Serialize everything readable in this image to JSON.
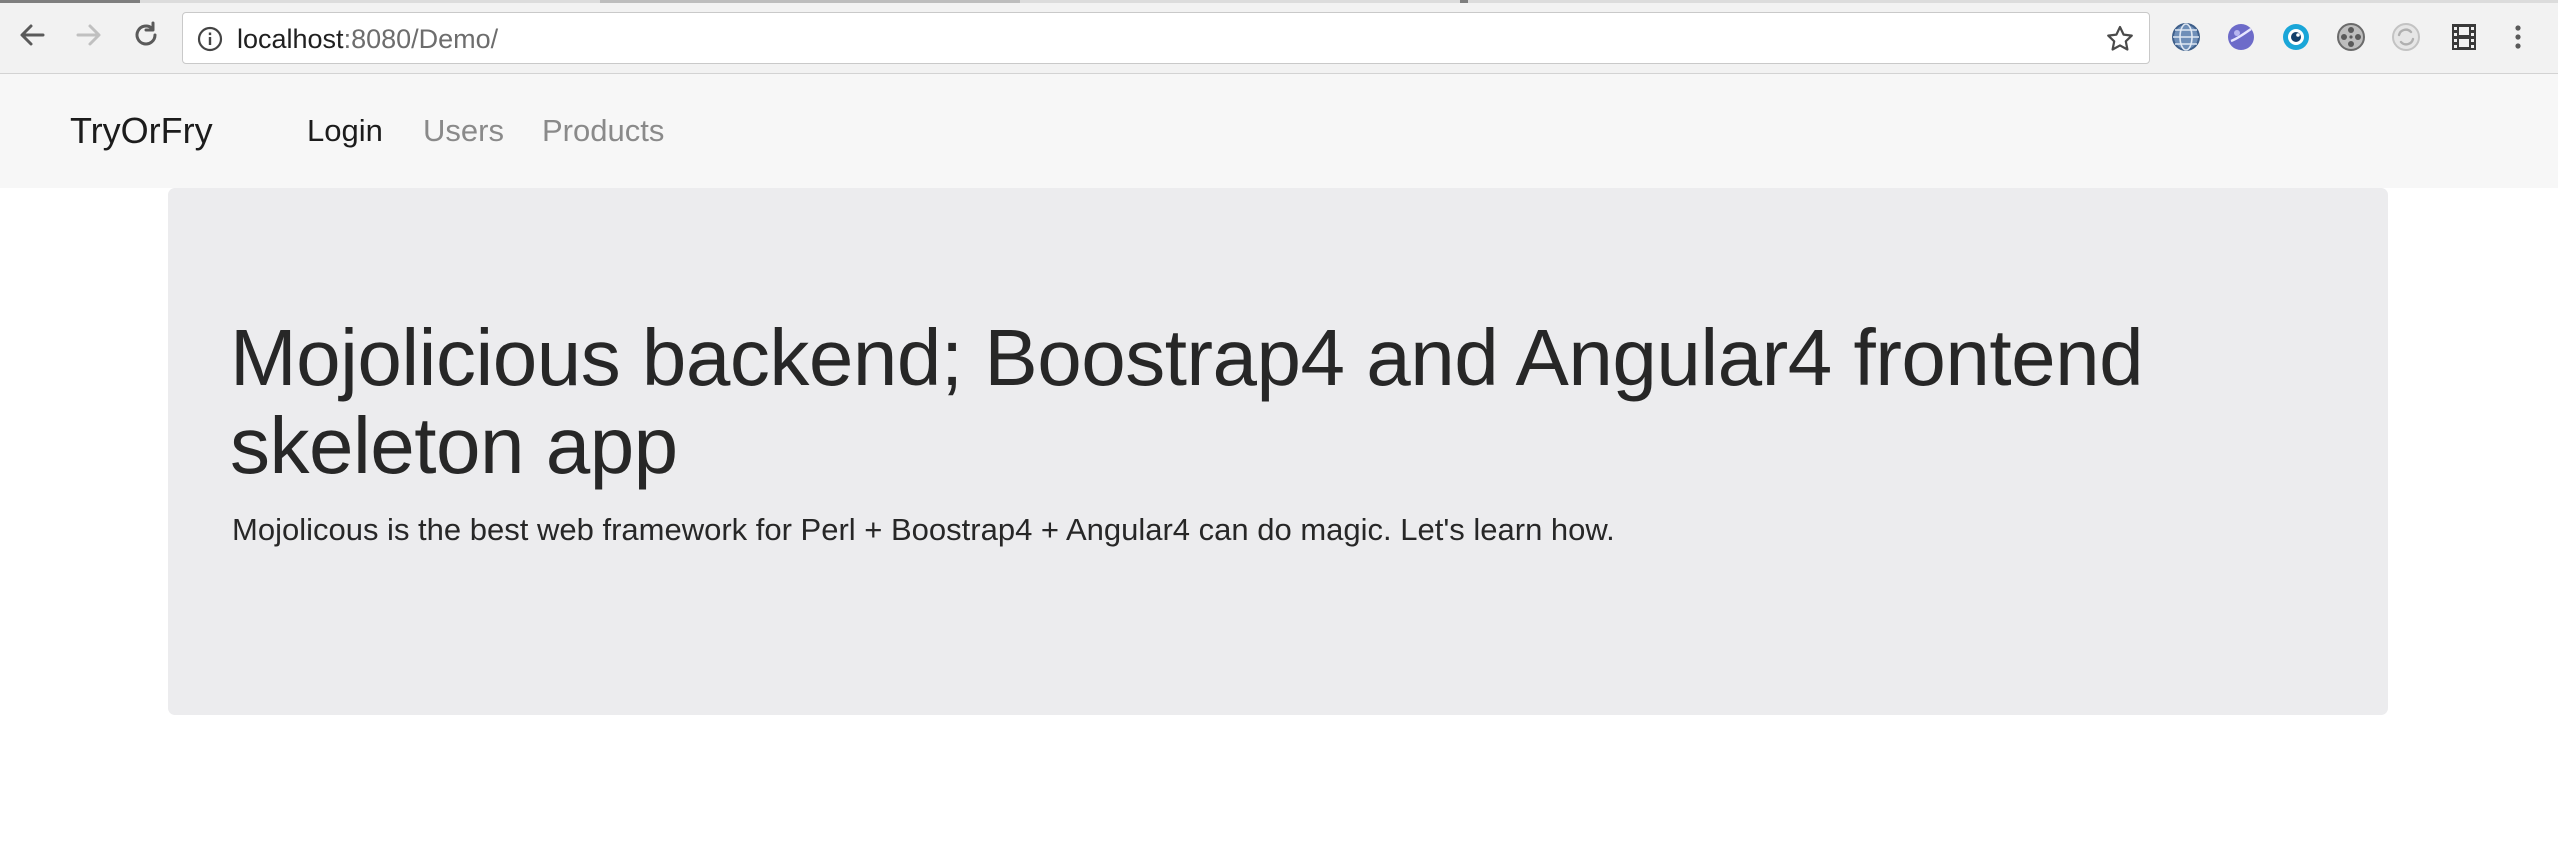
{
  "browser": {
    "url_host": "localhost",
    "url_path": ":8080/Demo/",
    "icons": {
      "back": "back-arrow-icon",
      "forward": "forward-arrow-icon",
      "reload": "reload-icon",
      "info": "info-icon",
      "bookmark": "star-icon",
      "menu": "kebab-menu-icon"
    },
    "extensions": [
      "globe-icon",
      "planet-icon",
      "eye-icon",
      "film-reel-icon",
      "sync-icon",
      "filmstrip-icon"
    ]
  },
  "navbar": {
    "brand": "TryOrFry",
    "links": [
      {
        "label": "Login",
        "active": true
      },
      {
        "label": "Users",
        "active": false
      },
      {
        "label": "Products",
        "active": false
      }
    ]
  },
  "jumbotron": {
    "heading": "Mojolicious backend; Boostrap4 and Angular4 frontend skeleton app",
    "lead": "Mojolicous is the best web framework for Perl + Boostrap4 + Angular4 can do magic. Let's learn how."
  },
  "colors": {
    "navbar_bg": "#f7f7f7",
    "jumbotron_bg": "#ececee",
    "text": "#272727",
    "inactive_link": "#8a8a8a"
  }
}
